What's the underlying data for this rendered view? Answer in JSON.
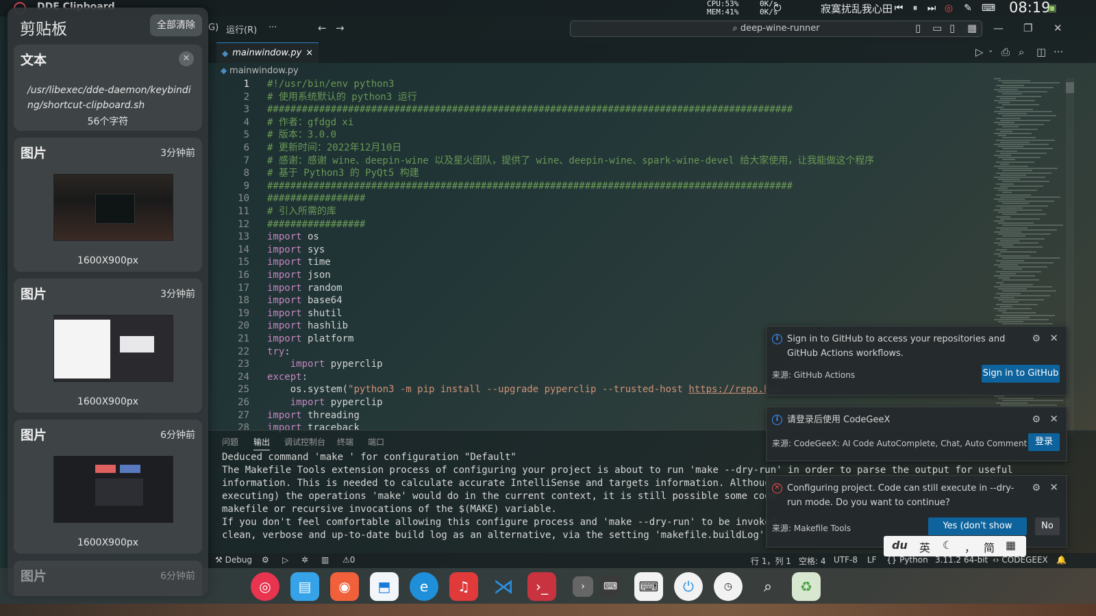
{
  "topbar": {
    "app_title": "DDE Clipboard",
    "cpu": "CPU:53% ",
    "mem": "MEM:41% ",
    "net_up": "0K/s",
    "net_down": "0K/s",
    "song": "寂寞扰乱我心田",
    "clock": "08:19"
  },
  "clipboard": {
    "title": "剪贴板",
    "clear_all": "全部清除",
    "cards": [
      {
        "type": "文本",
        "path": "/usr/libexec/dde-daemon/keybinding/shortcut-clipboard.sh",
        "count": "56个字符"
      },
      {
        "type": "图片",
        "time": "3分钟前",
        "size": "1600X900px"
      },
      {
        "type": "图片",
        "time": "3分钟前",
        "size": "1600X900px"
      },
      {
        "type": "图片",
        "time": "6分钟前",
        "size": "1600X900px"
      },
      {
        "type": "图片",
        "time": "6分钟前"
      }
    ]
  },
  "vscode": {
    "menu": {
      "partial": "G)",
      "run": "运行(R)",
      "more": "···"
    },
    "command_center": "deep-wine-runner",
    "tab": {
      "name": "mainwindow.py",
      "close": "×"
    },
    "breadcrumb": "mainwindow.py",
    "code": [
      {
        "n": "1",
        "t": "#!/usr/bin/env python3",
        "k": "com"
      },
      {
        "n": "2",
        "t": "# 使用系统默认的 python3 运行",
        "k": "com"
      },
      {
        "n": "3",
        "t": "###########################################################################################",
        "k": "com"
      },
      {
        "n": "4",
        "t": "# 作者：gfdgd xi",
        "k": "com"
      },
      {
        "n": "5",
        "t": "# 版本：3.0.0",
        "k": "com"
      },
      {
        "n": "6",
        "t": "# 更新时间：2022年12月10日",
        "k": "com"
      },
      {
        "n": "7",
        "t": "# 感谢：感谢 wine、deepin-wine 以及星火团队，提供了 wine、deepin-wine、spark-wine-devel 给大家使用，让我能做这个程序",
        "k": "com"
      },
      {
        "n": "8",
        "t": "# 基于 Python3 的 PyQt5 构建",
        "k": "com"
      },
      {
        "n": "9",
        "t": "###########################################################################################",
        "k": "com"
      },
      {
        "n": "10",
        "t": "#################",
        "k": "com"
      },
      {
        "n": "11",
        "t": "# 引入所需的库",
        "k": "com"
      },
      {
        "n": "12",
        "t": "#################",
        "k": "com"
      },
      {
        "n": "13",
        "kw": "import",
        "t": " os"
      },
      {
        "n": "14",
        "kw": "import",
        "t": " sys"
      },
      {
        "n": "15",
        "kw": "import",
        "t": " time"
      },
      {
        "n": "16",
        "kw": "import",
        "t": " json"
      },
      {
        "n": "17",
        "kw": "import",
        "t": " random"
      },
      {
        "n": "18",
        "kw": "import",
        "t": " base64"
      },
      {
        "n": "19",
        "kw": "import",
        "t": " shutil"
      },
      {
        "n": "20",
        "kw": "import",
        "t": " hashlib"
      },
      {
        "n": "21",
        "kw": "import",
        "t": " platform"
      },
      {
        "n": "22",
        "kw": "try",
        "t": ":"
      },
      {
        "n": "23",
        "pre": "    ",
        "kw": "import",
        "t": " pyperclip"
      },
      {
        "n": "24",
        "kw": "except",
        "t": ":"
      },
      {
        "n": "25",
        "pre": "    ",
        "t": "os.system(",
        "str": "\"python3 -m pip install --upgrade pyperclip --trusted-host ",
        "url": "https://repo.hua"
      },
      {
        "n": "26",
        "pre": "    ",
        "kw": "import",
        "t": " pyperclip"
      },
      {
        "n": "27",
        "kw": "import",
        "t": " threading"
      },
      {
        "n": "28",
        "kw": "import",
        "t": " traceback"
      }
    ],
    "panel": {
      "tabs": [
        "问题",
        "输出",
        "调试控制台",
        "终端",
        "端口"
      ],
      "active_tab": "输出",
      "output": [
        "Deduced command 'make ' for configuration \"Default\"",
        "The Makefile Tools extension process of configuring your project is about to run 'make --dry-run' in order to parse the output for useful",
        "information. This is needed to calculate accurate IntelliSense and targets information. Although",
        "executing) the operations 'make' would do in the current context, it is still possible some code",
        "makefile or recursive invocations of the $(MAKE) variable.",
        "If you don't feel comfortable allowing this configure process and 'make --dry-run' to be invoked",
        "clean, verbose and up-to-date build log as an alternative, via the setting 'makefile.buildLog'."
      ]
    },
    "status": {
      "debug": "Debug",
      "errors": "0",
      "position": "行 1，列 1",
      "spaces": "空格: 4",
      "encoding": "UTF-8",
      "eol": "LF",
      "language": "Python",
      "interpreter": "3.11.2 64-bit",
      "codegeex": "CODEGEEX"
    },
    "notifications": [
      {
        "message": "Sign in to GitHub to access your repositories and GitHub Actions workflows.",
        "source": "来源: GitHub Actions",
        "button": "Sign in to GitHub"
      },
      {
        "message": "请登录后使用 CodeGeeX",
        "source": "来源: CodeGeeX: AI Code AutoComplete, Chat, Auto Comment",
        "button": "登录"
      },
      {
        "message": "Configuring project. Code can still execute in --dry-run mode. Do you want to continue?",
        "source": "来源: Makefile Tools",
        "button": "Yes (don't show again)",
        "button2": "No"
      }
    ]
  },
  "ime": {
    "logo": "du",
    "lang": "英",
    "punct": "，",
    "script": "简"
  },
  "dock_icons": [
    "deepin-icon",
    "file-manager-icon",
    "screen-recorder-icon",
    "app-store-icon",
    "edge-browser-icon",
    "music-icon",
    "vscode-icon",
    "terminal-icon",
    "dock-expand-icon",
    "keyboard-icon",
    "virtual-keyboard-icon",
    "power-icon",
    "clock-icon",
    "search-icon",
    "trash-icon"
  ],
  "colors": {
    "accent": "#0e639c",
    "comment": "#6a9955",
    "keyword": "#c586c0",
    "string": "#ce9178"
  }
}
